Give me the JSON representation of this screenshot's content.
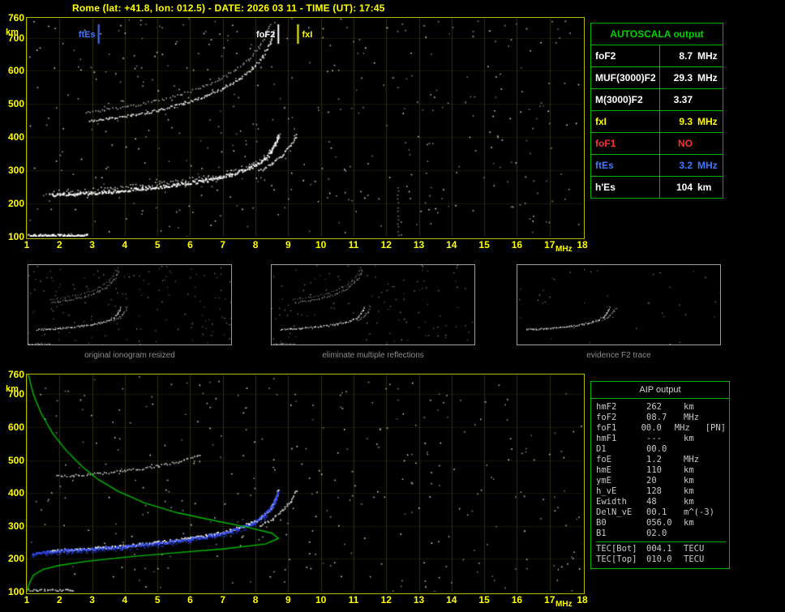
{
  "header": {
    "title": "Rome (lat: +41.8, lon: 012.5) - DATE: 2026 03 11 - TIME (UT): 17:45"
  },
  "colors": {
    "axis": "#ffff00",
    "table_border": "#00b400",
    "profile": "#00c000",
    "restored_trace": "#3550ff"
  },
  "autoscala_table": {
    "title": "AUTOSCALA output",
    "rows": [
      {
        "label": "foF2",
        "value": "8.7",
        "unit": "MHz",
        "color": "#ffffff"
      },
      {
        "label": "MUF(3000)F2",
        "value": "29.3",
        "unit": "MHz",
        "color": "#ffffff"
      },
      {
        "label": "M(3000)F2",
        "value": "3.37",
        "unit": "",
        "color": "#ffffff"
      },
      {
        "label": "fxI",
        "value": "9.3",
        "unit": "MHz",
        "color": "#ffff00"
      },
      {
        "label": "foF1",
        "value": "NO",
        "unit": "",
        "color": "#ff3030"
      },
      {
        "label": "ftEs",
        "value": "3.2",
        "unit": "MHz",
        "color": "#4477ff"
      },
      {
        "label": "h'Es",
        "value": "104",
        "unit": "km",
        "color": "#ffffff"
      }
    ]
  },
  "thumbnails": [
    {
      "caption": "original ionogram resized"
    },
    {
      "caption": "eliminate multiple reflections"
    },
    {
      "caption": "evidence F2 trace"
    }
  ],
  "aip_table": {
    "title": "AIP output",
    "rows": [
      {
        "label": "hmF2",
        "value": "262",
        "unit": "km"
      },
      {
        "label": "foF2",
        "value": "08.7",
        "unit": "MHz"
      },
      {
        "label": "foF1",
        "value": "00.0",
        "unit": "MHz   [PN]"
      },
      {
        "label": "hmF1",
        "value": "---",
        "unit": "km"
      },
      {
        "label": "D1",
        "value": "00.0",
        "unit": ""
      },
      {
        "label": "foE",
        "value": "1.2",
        "unit": "MHz"
      },
      {
        "label": "hmE",
        "value": "110",
        "unit": "km"
      },
      {
        "label": "ymE",
        "value": "20",
        "unit": "km"
      },
      {
        "label": "h_vE",
        "value": "128",
        "unit": "km"
      },
      {
        "label": "Ewidth",
        "value": "48",
        "unit": "km"
      },
      {
        "label": "DelN_vE",
        "value": "00.1",
        "unit": "m^(-3)"
      },
      {
        "label": "B0",
        "value": "056.0",
        "unit": "km"
      },
      {
        "label": "B1",
        "value": "02.0",
        "unit": ""
      },
      {
        "label": "TEC[Bot]",
        "value": "004.1",
        "unit": "TECU",
        "sep_before": true
      },
      {
        "label": "TEC[Top]",
        "value": "010.0",
        "unit": "TECU"
      }
    ]
  },
  "chart_data": [
    {
      "name": "scaled_ionogram",
      "type": "scatter",
      "title": "",
      "xlabel": "MHz",
      "ylabel": "km",
      "xlim": [
        1,
        18
      ],
      "ylim": [
        100,
        760
      ],
      "x_ticks": [
        1,
        2,
        3,
        4,
        5,
        6,
        7,
        8,
        9,
        10,
        11,
        12,
        13,
        14,
        15,
        16,
        17,
        18
      ],
      "y_ticks": [
        760,
        700,
        600,
        500,
        400,
        300,
        200,
        100
      ],
      "grid": true,
      "markers": [
        {
          "label": "ftEs",
          "freq_mhz": 3.2,
          "color": "#4477ff",
          "side": "left"
        },
        {
          "label": "foF2",
          "freq_mhz": 8.7,
          "color": "#ffffff",
          "side": "left"
        },
        {
          "label": "fxI",
          "freq_mhz": 9.3,
          "color": "#ffff00",
          "side": "right"
        }
      ],
      "traces": {
        "f2_ordinary": [
          [
            1.7,
            226
          ],
          [
            2.5,
            230
          ],
          [
            3.5,
            237
          ],
          [
            4.5,
            246
          ],
          [
            5.5,
            257
          ],
          [
            6.5,
            272
          ],
          [
            7.2,
            288
          ],
          [
            7.8,
            308
          ],
          [
            8.2,
            330
          ],
          [
            8.45,
            355
          ],
          [
            8.6,
            382
          ],
          [
            8.68,
            408
          ]
        ],
        "f2_extraordinary": [
          [
            8.1,
            300
          ],
          [
            8.5,
            322
          ],
          [
            8.8,
            348
          ],
          [
            9.05,
            375
          ],
          [
            9.25,
            408
          ]
        ],
        "second_reflection": [
          [
            2.9,
            452
          ],
          [
            3.5,
            458
          ],
          [
            4.2,
            468
          ],
          [
            5.0,
            483
          ],
          [
            5.8,
            503
          ],
          [
            6.5,
            528
          ],
          [
            7.0,
            550
          ],
          [
            7.5,
            578
          ],
          [
            7.9,
            610
          ],
          [
            8.2,
            645
          ],
          [
            8.45,
            688
          ],
          [
            8.55,
            715
          ]
        ],
        "es_layer": [
          [
            1.05,
            106
          ],
          [
            2.85,
            106
          ]
        ],
        "noise_column": [
          [
            12.35,
            105
          ],
          [
            12.35,
            250
          ]
        ]
      }
    },
    {
      "name": "profile_ionogram",
      "type": "scatter",
      "title": "",
      "xlabel": "MHz",
      "ylabel": "km",
      "xlim": [
        1,
        18
      ],
      "ylim": [
        100,
        760
      ],
      "x_ticks": [
        1,
        2,
        3,
        4,
        5,
        6,
        7,
        8,
        9,
        10,
        11,
        12,
        13,
        14,
        15,
        16,
        17,
        18
      ],
      "y_ticks": [
        760,
        700,
        600,
        500,
        400,
        300,
        200,
        100
      ],
      "grid": true,
      "traces": {
        "f2_ordinary": [
          [
            1.7,
            226
          ],
          [
            2.5,
            230
          ],
          [
            3.5,
            237
          ],
          [
            4.5,
            246
          ],
          [
            5.5,
            257
          ],
          [
            6.5,
            272
          ],
          [
            7.2,
            288
          ],
          [
            7.8,
            308
          ],
          [
            8.2,
            330
          ],
          [
            8.45,
            355
          ],
          [
            8.6,
            382
          ],
          [
            8.68,
            408
          ]
        ],
        "f2_extraordinary": [
          [
            8.1,
            300
          ],
          [
            8.5,
            322
          ],
          [
            8.8,
            348
          ],
          [
            9.05,
            375
          ],
          [
            9.25,
            408
          ]
        ],
        "second_reflection_partial": [
          [
            1.9,
            452
          ],
          [
            3.0,
            458
          ],
          [
            4.0,
            468
          ],
          [
            5.0,
            483
          ],
          [
            5.8,
            500
          ],
          [
            6.3,
            516
          ]
        ],
        "restored_trace_blue": [
          [
            1.15,
            218
          ],
          [
            1.6,
            222
          ],
          [
            2.2,
            227
          ],
          [
            3.0,
            231
          ],
          [
            4.0,
            239
          ],
          [
            5.0,
            249
          ],
          [
            6.0,
            261
          ],
          [
            6.8,
            275
          ],
          [
            7.4,
            291
          ],
          [
            7.9,
            310
          ],
          [
            8.25,
            332
          ],
          [
            8.45,
            355
          ],
          [
            8.6,
            380
          ],
          [
            8.68,
            404
          ]
        ],
        "es_layer": [
          [
            1.05,
            106
          ],
          [
            2.4,
            106
          ]
        ]
      },
      "profile_green": [
        [
          1.05,
          760
        ],
        [
          1.2,
          700
        ],
        [
          1.45,
          640
        ],
        [
          1.8,
          580
        ],
        [
          2.2,
          530
        ],
        [
          2.7,
          480
        ],
        [
          3.2,
          440
        ],
        [
          3.8,
          405
        ],
        [
          4.6,
          370
        ],
        [
          5.6,
          340
        ],
        [
          6.8,
          315
        ],
        [
          7.8,
          295
        ],
        [
          8.5,
          278
        ],
        [
          8.7,
          262
        ],
        [
          8.3,
          245
        ],
        [
          7.0,
          230
        ],
        [
          5.5,
          218
        ],
        [
          4.0,
          205
        ],
        [
          2.8,
          192
        ],
        [
          2.0,
          180
        ],
        [
          1.5,
          168
        ],
        [
          1.2,
          150
        ],
        [
          1.1,
          130
        ],
        [
          1.0,
          100
        ]
      ]
    }
  ]
}
